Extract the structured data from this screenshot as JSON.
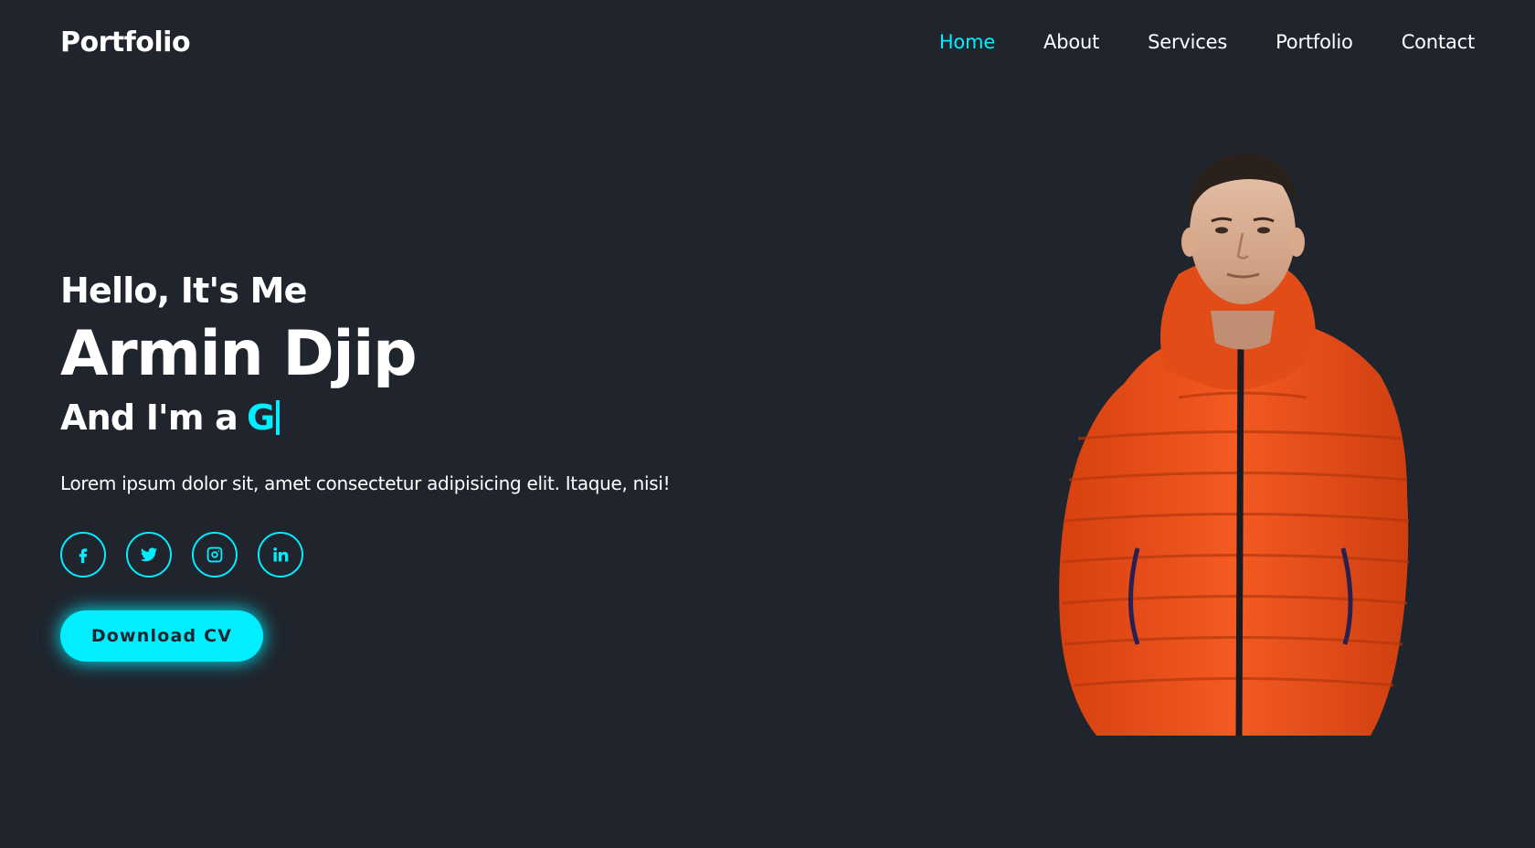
{
  "header": {
    "logo": "Portfolio",
    "nav": [
      {
        "label": "Home",
        "active": true
      },
      {
        "label": "About",
        "active": false
      },
      {
        "label": "Services",
        "active": false
      },
      {
        "label": "Portfolio",
        "active": false
      },
      {
        "label": "Contact",
        "active": false
      }
    ]
  },
  "hero": {
    "greeting": "Hello, It's Me",
    "name": "Armin Djip",
    "role_prefix": "And I'm a",
    "role_typed": "G",
    "description": "Lorem ipsum dolor sit, amet consectetur adipisicing elit. Itaque, nisi!",
    "socials": [
      {
        "icon": "facebook-icon"
      },
      {
        "icon": "twitter-icon"
      },
      {
        "icon": "instagram-icon"
      },
      {
        "icon": "linkedin-icon"
      }
    ],
    "cta_label": "Download CV"
  },
  "colors": {
    "background": "#1f242d",
    "accent": "#00eeff",
    "text": "#ffffff",
    "jacket": "#f0511c"
  }
}
